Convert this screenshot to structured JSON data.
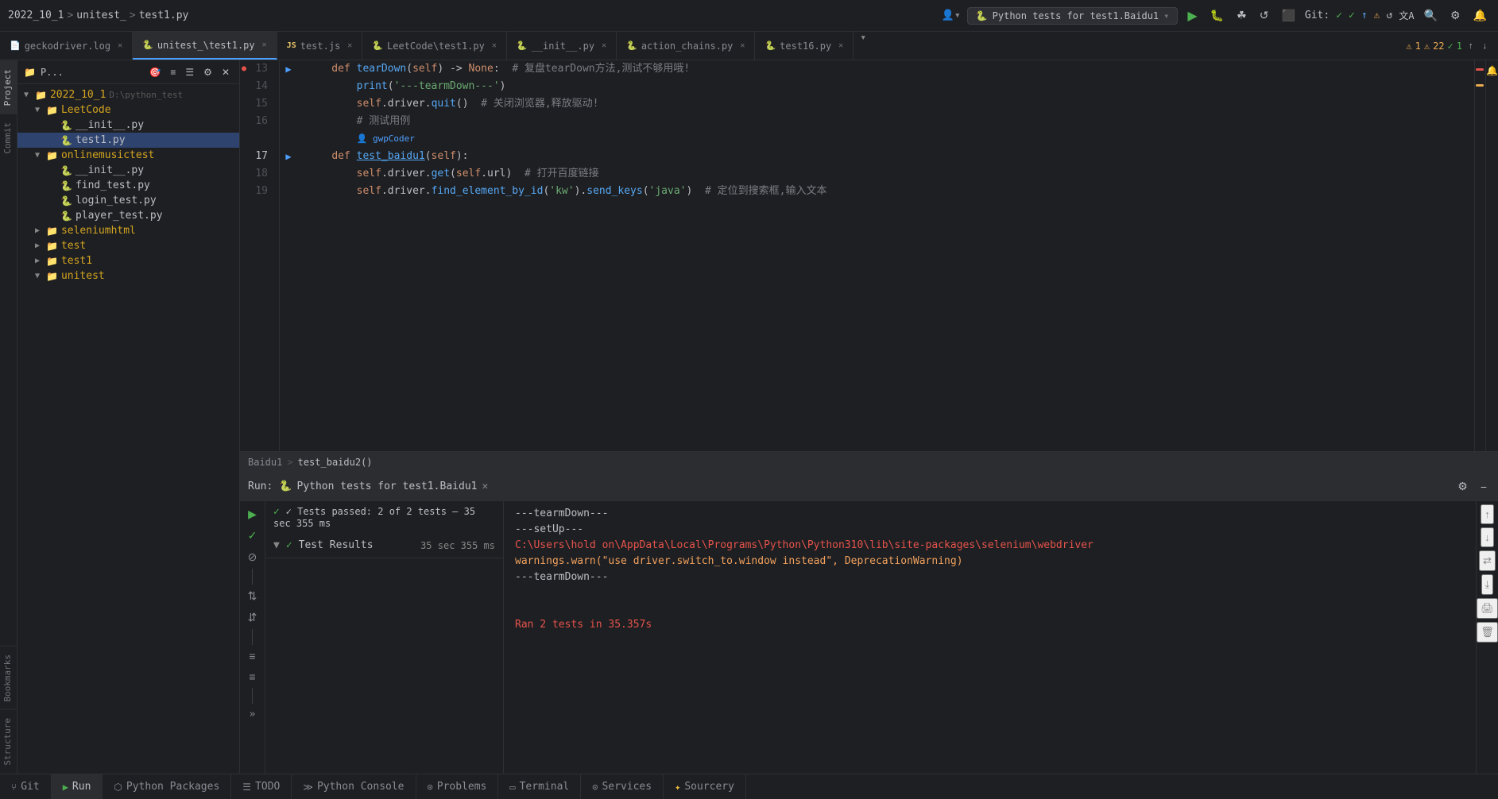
{
  "title_bar": {
    "breadcrumb": {
      "project": "2022_10_1",
      "sep1": ">",
      "folder": "unitest_",
      "sep2": ">",
      "file": "test1.py"
    },
    "run_config": "Python tests for test1.Baidu1",
    "run_config_arrow": "▾",
    "git_label": "Git:",
    "icons": {
      "user": "👤",
      "play": "▶",
      "debug": "🐛",
      "rerun": "↺",
      "stop": "⬛",
      "git_check1": "✓",
      "git_check2": "✓",
      "git_arrow": "↑",
      "git_warn": "⚠",
      "git_sync": "↺",
      "translate": "文A",
      "search": "🔍",
      "settings": "⚙",
      "notifications": "🔔"
    }
  },
  "tabs": [
    {
      "id": "geckodriver",
      "label": "geckodriver.log",
      "icon": "📄",
      "active": false,
      "closable": true
    },
    {
      "id": "test1",
      "label": "unitest_\\test1.py",
      "icon": "🐍",
      "active": true,
      "closable": true
    },
    {
      "id": "testjs",
      "label": "test.js",
      "icon": "JS",
      "active": false,
      "closable": true
    },
    {
      "id": "leetcode_test1",
      "label": "LeetCode\\test1.py",
      "icon": "🐍",
      "active": false,
      "closable": true
    },
    {
      "id": "init",
      "label": "__init__.py",
      "icon": "🐍",
      "active": false,
      "closable": true
    },
    {
      "id": "action_chains",
      "label": "action_chains.py",
      "icon": "🐍",
      "active": false,
      "closable": true
    },
    {
      "id": "test16",
      "label": "test16.py",
      "icon": "🐍",
      "active": false,
      "closable": true
    }
  ],
  "tabs_more": "▾",
  "error_indicators": {
    "warning_icon": "⚠",
    "warning_count": "1",
    "error_icon": "⚠",
    "error_count": "22",
    "ok_icon": "✓",
    "ok_count": "1",
    "up_arrow": "↑",
    "down_arrow": "↓"
  },
  "project_panel": {
    "title": "P...",
    "icons": [
      "📁",
      "🎯",
      "≡",
      "☰",
      "⚙",
      "✕"
    ],
    "tree": [
      {
        "indent": 0,
        "arrow": "▼",
        "icon": "📁",
        "label": "2022_10_1",
        "suffix": " D:\\python_test",
        "type": "root"
      },
      {
        "indent": 1,
        "arrow": "▼",
        "icon": "📁",
        "label": "LeetCode",
        "type": "folder"
      },
      {
        "indent": 2,
        "arrow": " ",
        "icon": "🐍",
        "label": "__init__.py",
        "type": "py"
      },
      {
        "indent": 2,
        "arrow": " ",
        "icon": "🐍",
        "label": "test1.py",
        "type": "py",
        "selected": true
      },
      {
        "indent": 1,
        "arrow": "▼",
        "icon": "📁",
        "label": "onlinemusictest",
        "type": "folder"
      },
      {
        "indent": 2,
        "arrow": " ",
        "icon": "🐍",
        "label": "__init__.py",
        "type": "py"
      },
      {
        "indent": 2,
        "arrow": " ",
        "icon": "🐍",
        "label": "find_test.py",
        "type": "py"
      },
      {
        "indent": 2,
        "arrow": " ",
        "icon": "🐍",
        "label": "login_test.py",
        "type": "py"
      },
      {
        "indent": 2,
        "arrow": " ",
        "icon": "🐍",
        "label": "player_test.py",
        "type": "py"
      },
      {
        "indent": 1,
        "arrow": "▶",
        "icon": "📁",
        "label": "seleniumhtml",
        "type": "folder"
      },
      {
        "indent": 1,
        "arrow": "▶",
        "icon": "📁",
        "label": "test",
        "type": "folder"
      },
      {
        "indent": 1,
        "arrow": "▶",
        "icon": "📁",
        "label": "test1",
        "type": "folder"
      },
      {
        "indent": 1,
        "arrow": "▼",
        "icon": "📁",
        "label": "unitest",
        "type": "folder"
      }
    ]
  },
  "vertical_tabs": [
    {
      "label": "Project",
      "active": true
    },
    {
      "label": "Commit",
      "active": false
    },
    {
      "label": "Bookmarks",
      "active": false
    },
    {
      "label": "Structure",
      "active": false
    }
  ],
  "code_lines": [
    {
      "num": "13",
      "run_arrow": "▶",
      "content": "    def tearDown(self) -> None:  # 复盘tearDown方法,测试不够用哦!"
    },
    {
      "num": "14",
      "content": "        print('---tearmDown---')"
    },
    {
      "num": "15",
      "content": "        self.driver.quit()  # 关闭浏览器,释放驱动!"
    },
    {
      "num": "16",
      "content": "        # 测试用例"
    },
    {
      "num": "",
      "content": "        👤 gwpCoder"
    },
    {
      "num": "17",
      "run_arrow": "▶",
      "content": "    def test_baidu1(self):"
    },
    {
      "num": "18",
      "content": "        self.driver.get(self.url)  # 打开百度链接"
    },
    {
      "num": "19",
      "content": "        self.driver.find_element_by_id('kw').send_keys('java')  # 定位到搜索框,输入文本"
    }
  ],
  "editor_breadcrumb": {
    "item1": "Baidu1",
    "sep": ">",
    "item2": "test_baidu2()"
  },
  "run_panel": {
    "title": "Python tests for test1.Baidu1",
    "close": "−",
    "settings": "⚙",
    "toolbar_buttons": [
      {
        "id": "play",
        "icon": "▶",
        "active": true,
        "title": "Run"
      },
      {
        "id": "check",
        "icon": "✓",
        "title": "Check"
      },
      {
        "id": "no",
        "icon": "⊘",
        "title": "Stop"
      },
      {
        "id": "sort1",
        "icon": "⇅",
        "title": "Sort"
      },
      {
        "id": "sort2",
        "icon": "⇵",
        "title": "Sort desc"
      },
      {
        "id": "expand",
        "icon": "≡",
        "title": "Expand"
      },
      {
        "id": "collapse",
        "icon": "≡",
        "title": "Collapse"
      }
    ],
    "ellipsis": "»",
    "test_pass_message": "✓ Tests passed: 2 of 2 tests – 35 sec 355 ms",
    "test_results": {
      "arrow": "▼",
      "check": "✓",
      "name": "Test Results",
      "time": "35 sec 355 ms"
    },
    "output_lines": [
      {
        "type": "normal",
        "text": "---tearmDown---"
      },
      {
        "type": "normal",
        "text": "---setUp---"
      },
      {
        "type": "path",
        "text": "C:\\Users\\hold on\\AppData\\Local\\Programs\\Python\\Python310\\lib\\site-packages\\selenium\\webdriver"
      },
      {
        "type": "warn",
        "text": "  warnings.warn(\"use driver.switch_to.window instead\", DeprecationWarning)"
      },
      {
        "type": "normal",
        "text": "---tearmDown---"
      },
      {
        "type": "empty",
        "text": ""
      },
      {
        "type": "empty",
        "text": ""
      },
      {
        "type": "red",
        "text": "Ran 2 tests in 35.357s"
      }
    ],
    "right_buttons": [
      "↑",
      "↓",
      "⇄",
      "⤓",
      "🖨",
      "🗑"
    ]
  },
  "status_bar": {
    "items": [
      {
        "id": "git",
        "icon": "⑂",
        "label": "Git"
      },
      {
        "id": "run",
        "icon": "▶",
        "label": "Run"
      },
      {
        "id": "python-packages",
        "icon": "⬡",
        "label": "Python Packages"
      },
      {
        "id": "todo",
        "icon": "☰",
        "label": "TODO"
      },
      {
        "id": "python-console",
        "icon": "≫",
        "label": "Python Console"
      },
      {
        "id": "problems",
        "icon": "⊙",
        "label": "Problems"
      },
      {
        "id": "terminal",
        "icon": "▭",
        "label": "Terminal"
      },
      {
        "id": "services",
        "icon": "⊙",
        "label": "Services"
      },
      {
        "id": "sourcery",
        "icon": "✦",
        "label": "Sourcery"
      }
    ]
  }
}
